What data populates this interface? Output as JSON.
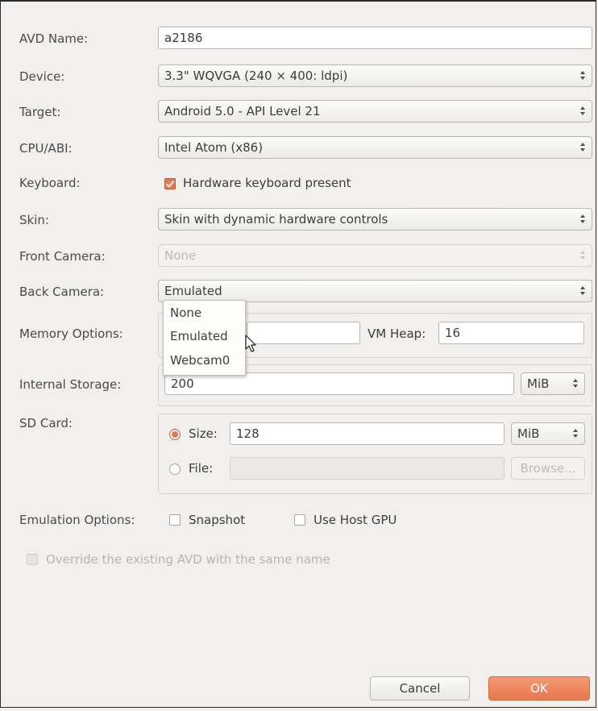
{
  "form": {
    "avd_name": {
      "label": "AVD Name:",
      "value": "a2186"
    },
    "device": {
      "label": "Device:",
      "value": "3.3\" WQVGA (240 × 400: ldpi)"
    },
    "target": {
      "label": "Target:",
      "value": "Android 5.0 - API Level 21"
    },
    "cpu_abi": {
      "label": "CPU/ABI:",
      "value": "Intel Atom (x86)"
    },
    "keyboard": {
      "label": "Keyboard:",
      "checkbox_label": "Hardware keyboard present",
      "checked": true
    },
    "skin": {
      "label": "Skin:",
      "value": "Skin with dynamic hardware controls"
    },
    "front_camera": {
      "label": "Front Camera:",
      "value": "None"
    },
    "back_camera": {
      "label": "Back Camera:",
      "value": "Emulated"
    },
    "memory": {
      "label": "Memory Options:",
      "vm_heap_label": "VM Heap:",
      "vm_heap_value": "16"
    },
    "internal_storage": {
      "label": "Internal Storage:",
      "value": "200",
      "unit": "MiB"
    },
    "sd_card": {
      "label": "SD Card:",
      "size_label": "Size:",
      "size_value": "128",
      "size_unit": "MiB",
      "file_label": "File:",
      "browse_label": "Browse..."
    },
    "emulation": {
      "label": "Emulation Options:",
      "snapshot_label": "Snapshot",
      "host_gpu_label": "Use Host GPU"
    },
    "override_label": "Override the existing AVD with the same name"
  },
  "dropdown": {
    "options": [
      "None",
      "Emulated",
      "Webcam0"
    ]
  },
  "buttons": {
    "cancel": "Cancel",
    "ok": "OK"
  },
  "colors": {
    "accent": "#e8774a",
    "background": "#f1f0ee"
  }
}
